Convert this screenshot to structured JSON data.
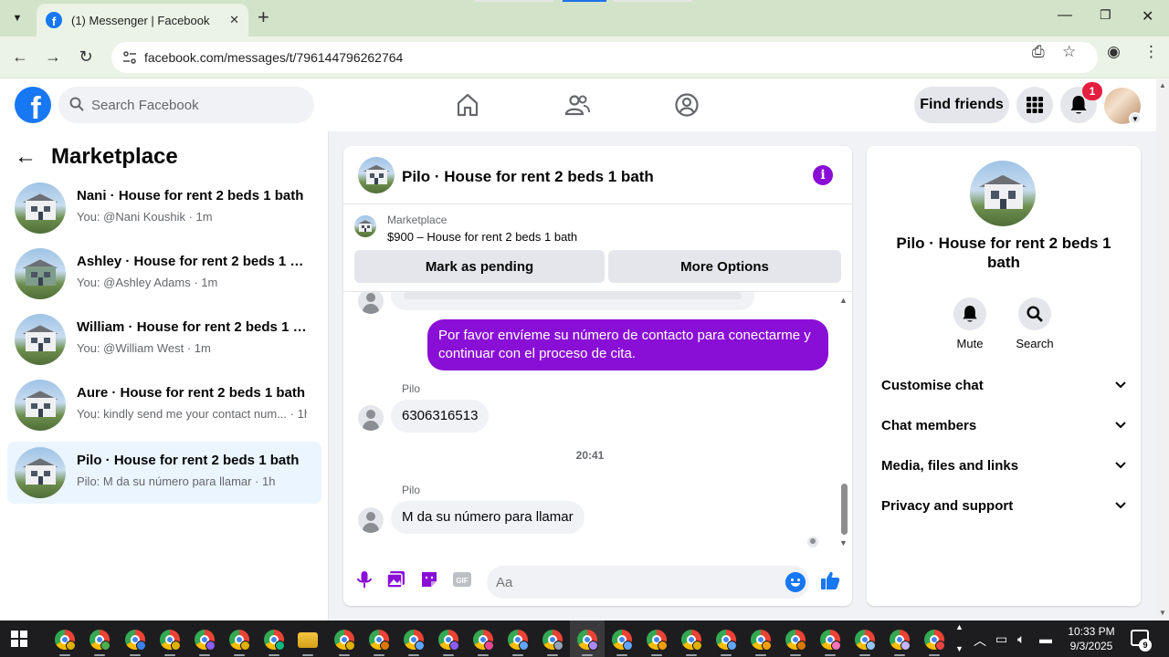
{
  "browser": {
    "tab_title": "(1) Messenger | Facebook",
    "url": "facebook.com/messages/t/796144796262764"
  },
  "header": {
    "search_placeholder": "Search Facebook",
    "find_friends": "Find friends",
    "notification_count": "1"
  },
  "sidebar": {
    "title": "Marketplace",
    "conversations": [
      {
        "name": "Nani · House for rent 2 beds 1 bath",
        "snippet": "You: @Nani Koushik · 1m"
      },
      {
        "name": "Ashley · House for rent 2 beds 1 ba...",
        "snippet": "You: @Ashley Adams · 1m"
      },
      {
        "name": "William · House for rent 2 beds 1 b...",
        "snippet": "You: @William West · 1m"
      },
      {
        "name": "Aure · House for rent 2 beds 1 bath",
        "snippet": "You: kindly send me your contact num... · 1h"
      },
      {
        "name": "Pilo · House for rent 2 beds 1 bath",
        "snippet": "Pilo: M da su número para llamar · 1h"
      }
    ]
  },
  "chat": {
    "title": "Pilo · House for rent 2 beds 1 bath",
    "marketplace_label": "Marketplace",
    "listing": "$900 – House for rent 2 beds 1 bath",
    "btn_pending": "Mark as pending",
    "btn_more": "More Options",
    "outgoing_message": "Por favor envíeme su número de contacto para conectarme y continuar con el proceso de cita.",
    "sender1": "Pilo",
    "incoming1": "6306316513",
    "timestamp": "20:41",
    "sender2": "Pilo",
    "incoming2": "M da su número para llamar",
    "input_placeholder": "Aa"
  },
  "details": {
    "name": "Pilo · House for rent 2 beds 1 bath",
    "mute": "Mute",
    "search": "Search",
    "sections": [
      "Customise chat",
      "Chat members",
      "Media, files and links",
      "Privacy and support"
    ]
  },
  "taskbar": {
    "time": "10:33 PM",
    "date": "9/3/2025",
    "notifications": "9"
  },
  "colors": {
    "facebook_blue": "#1877f2",
    "messenger_purple": "#8a0fd6",
    "notification_red": "#e41e3f"
  }
}
